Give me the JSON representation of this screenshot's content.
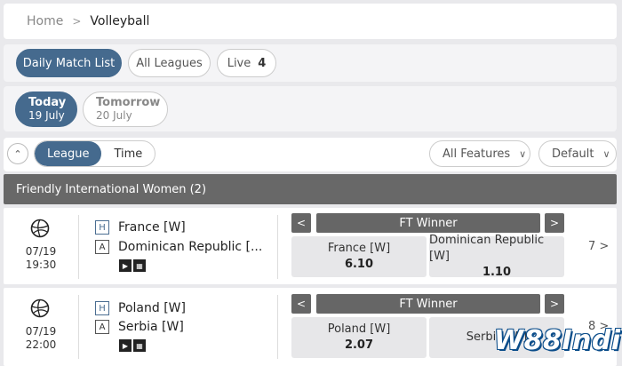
{
  "breadcrumb": {
    "home": "Home",
    "current": "Volleyball"
  },
  "tabs": {
    "daily": "Daily Match List",
    "all_leagues": "All Leagues",
    "live": "Live",
    "live_count": "4"
  },
  "days": [
    {
      "label": "Today",
      "date": "19 July"
    },
    {
      "label": "Tomorrow",
      "date": "20 July"
    }
  ],
  "view": {
    "league": "League",
    "time": "Time",
    "features": "All Features",
    "sort": "Default"
  },
  "league": {
    "name": "Friendly International Women (2)"
  },
  "matches": [
    {
      "date": "07/19",
      "time": "19:30",
      "home": "France [W]",
      "away": "Dominican Republic [...",
      "market": "FT Winner",
      "odds": [
        {
          "team": "France [W]",
          "price": "6.10"
        },
        {
          "team": "Dominican Republic [W]",
          "price": "1.10"
        }
      ],
      "more": "7 >"
    },
    {
      "date": "07/19",
      "time": "22:00",
      "home": "Poland [W]",
      "away": "Serbia [W]",
      "market": "FT Winner",
      "odds": [
        {
          "team": "Poland [W]",
          "price": "2.07"
        },
        {
          "team": "Serbia [W]",
          "price": ""
        }
      ],
      "more": "8 >"
    }
  ],
  "tags": {
    "home": "H",
    "away": "A"
  },
  "icons": {
    "collapse": "double-chevron-up-icon",
    "ball": "volleyball-icon",
    "video": "play-icon",
    "stats": "scoreboard-icon"
  },
  "watermark": "W88Indi"
}
